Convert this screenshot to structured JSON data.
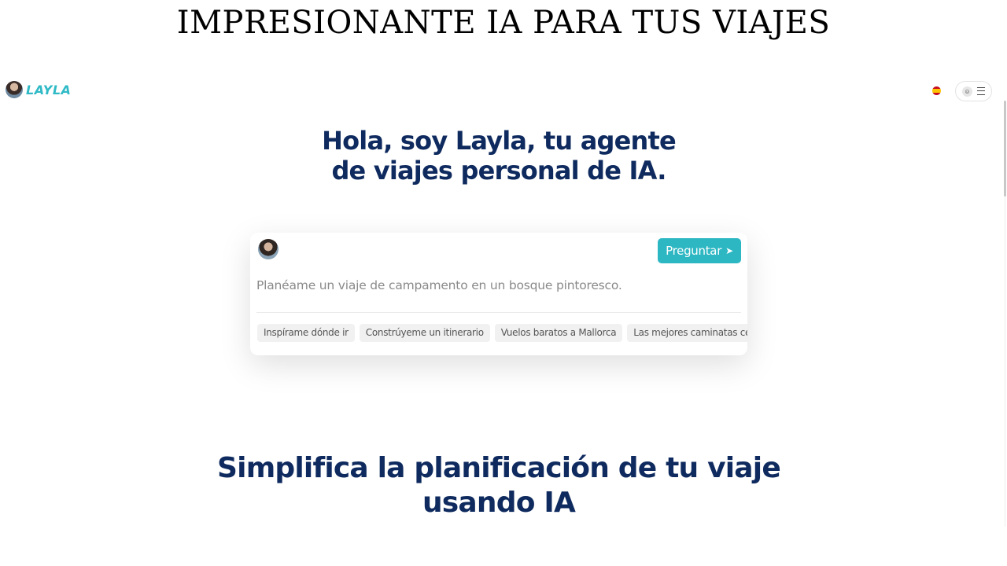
{
  "banner": {
    "title": "IMPRESIONANTE IA PARA TUS VIAJES"
  },
  "nav": {
    "logo_text": "LAYLA",
    "language_flag": "es-flag-icon",
    "menu_icons": [
      "user-icon",
      "hamburger-menu-icon"
    ]
  },
  "hero": {
    "line1": "Hola, soy Layla, tu agente",
    "line2": "de viajes personal de IA."
  },
  "chat": {
    "ask_label": "Preguntar",
    "placeholder": "Planéame un viaje de campamento en un bosque pintoresco.",
    "suggestions": [
      "Inspírame dónde ir",
      "Constrúyeme un itinerario",
      "Vuelos baratos a Mallorca",
      "Las mejores caminatas cerca de"
    ]
  },
  "section": {
    "line1": "Simplifica la planificación de tu viaje",
    "line2": "usando IA"
  },
  "colors": {
    "accent": "#2cb7c3",
    "heading": "#0e2a5e"
  }
}
